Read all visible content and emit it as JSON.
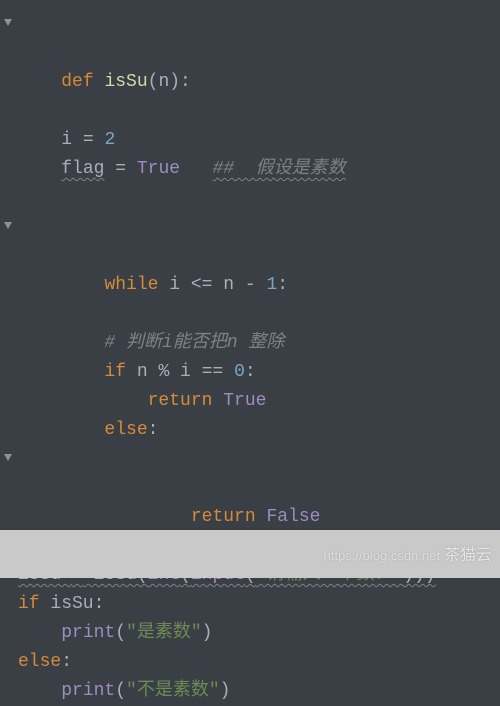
{
  "code": {
    "l1": {
      "kw": "def ",
      "fn": "isSu",
      "rest": "(n):"
    },
    "l2": {
      "indent": "    ",
      "v": "i",
      "op": " = ",
      "n": "2"
    },
    "l3": {
      "indent": "    ",
      "v": "flag",
      "op": " = ",
      "bi": "True",
      "sp": "   ",
      "cm": "##  假设是素数"
    },
    "l4": "",
    "l5": {
      "indent": "    ",
      "kw": "while ",
      "cond_a": "i ",
      "op1": "<=",
      "cond_b": " n ",
      "minus": "- ",
      "one": "1",
      "colon": ":"
    },
    "l6": {
      "indent": "        ",
      "cm": "# 判断i能否把n 整除"
    },
    "l7": {
      "indent": "        ",
      "kw": "if ",
      "a": "n ",
      "pct": "%",
      " b": " i ",
      "eq": "==",
      "sp": " ",
      "z": "0",
      "colon": ":"
    },
    "l8": {
      "indent": "            ",
      "kw": "return ",
      "bi": "True"
    },
    "l9": {
      "indent": "        ",
      "kw": "else",
      "colon": ":"
    },
    "l10": {
      "indent": "            ",
      "kw": "return ",
      "bi": "False"
    },
    "l11": {
      "a": "isSu ",
      "eq": "=",
      "b": " isSu(",
      "int": "int",
      "p1": "(",
      "inp": "input",
      "p2": "(",
      "s": "\"请输入一个数：\"",
      "end": ")))"
    },
    "l12": {
      "kw": "if ",
      "v": "isSu:"
    },
    "l13": {
      "indent": "    ",
      "fn": "print",
      "p": "(",
      "s": "\"是素数\"",
      "e": ")"
    },
    "l14": {
      "kw": "else",
      "colon": ":"
    },
    "l15": {
      "indent": "    ",
      "fn": "print",
      "p": "(",
      "s": "\"不是素数\"",
      "e": ")"
    }
  },
  "footer": {
    "url": "https://blog.csdn.net",
    "brand": "茶猫云"
  }
}
